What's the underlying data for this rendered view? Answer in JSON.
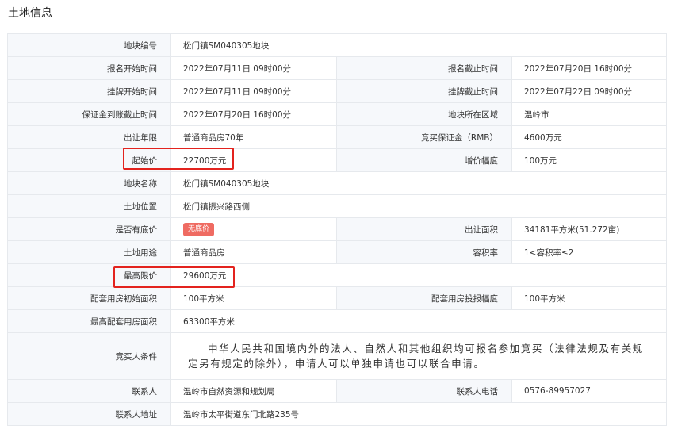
{
  "page_title": "土地信息",
  "rows": {
    "parcel_no": {
      "label": "地块编号",
      "value": "松门镇SM040305地块"
    },
    "reg_start": {
      "label": "报名开始时间",
      "value": "2022年07月11日 09时00分"
    },
    "reg_end": {
      "label": "报名截止时间",
      "value": "2022年07月20日 16时00分"
    },
    "list_start": {
      "label": "挂牌开始时间",
      "value": "2022年07月11日 09时00分"
    },
    "list_end": {
      "label": "挂牌截止时间",
      "value": "2022年07月22日 09时00分"
    },
    "deposit_deadline": {
      "label": "保证金到账截止时间",
      "value": "2022年07月20日 16时00分"
    },
    "region": {
      "label": "地块所在区域",
      "value": "温岭市"
    },
    "term": {
      "label": "出让年限",
      "value": "普通商品房70年"
    },
    "deposit": {
      "label": "竞买保证金（RMB）",
      "value": "4600万元"
    },
    "start_price": {
      "label": "起始价",
      "value": "22700万元"
    },
    "increment": {
      "label": "增价幅度",
      "value": "100万元"
    },
    "parcel_name": {
      "label": "地块名称",
      "value": "松门镇SM040305地块"
    },
    "location": {
      "label": "土地位置",
      "value": "松门镇振兴路西侧"
    },
    "reserve": {
      "label": "是否有底价",
      "badge": "无底价"
    },
    "area": {
      "label": "出让面积",
      "value": "34181平方米(51.272亩)"
    },
    "usage": {
      "label": "土地用途",
      "value": "普通商品房"
    },
    "far": {
      "label": "容积率",
      "value": "1<容积率≤2"
    },
    "max_price": {
      "label": "最高限价",
      "value": "29600万元"
    },
    "housing_initial": {
      "label": "配套用房初始面积",
      "value": "100平方米"
    },
    "housing_increment": {
      "label": "配套用房投报幅度",
      "value": "100平方米"
    },
    "housing_max": {
      "label": "最高配套用房面积",
      "value": "63300平方米"
    },
    "conditions": {
      "label": "竞买人条件",
      "value": "中华人民共和国境内外的法人、自然人和其他组织均可报名参加竞买（法律法规及有关规定另有规定的除外），申请人可以单独申请也可以联合申请。"
    },
    "contact": {
      "label": "联系人",
      "value": "温岭市自然资源和规划局"
    },
    "phone": {
      "label": "联系人电话",
      "value": "0576-89957027"
    },
    "address": {
      "label": "联系人地址",
      "value": "温岭市太平街道东门北路235号"
    }
  },
  "highlight_color": "#e3231e",
  "badge_color": "#ef6b62"
}
